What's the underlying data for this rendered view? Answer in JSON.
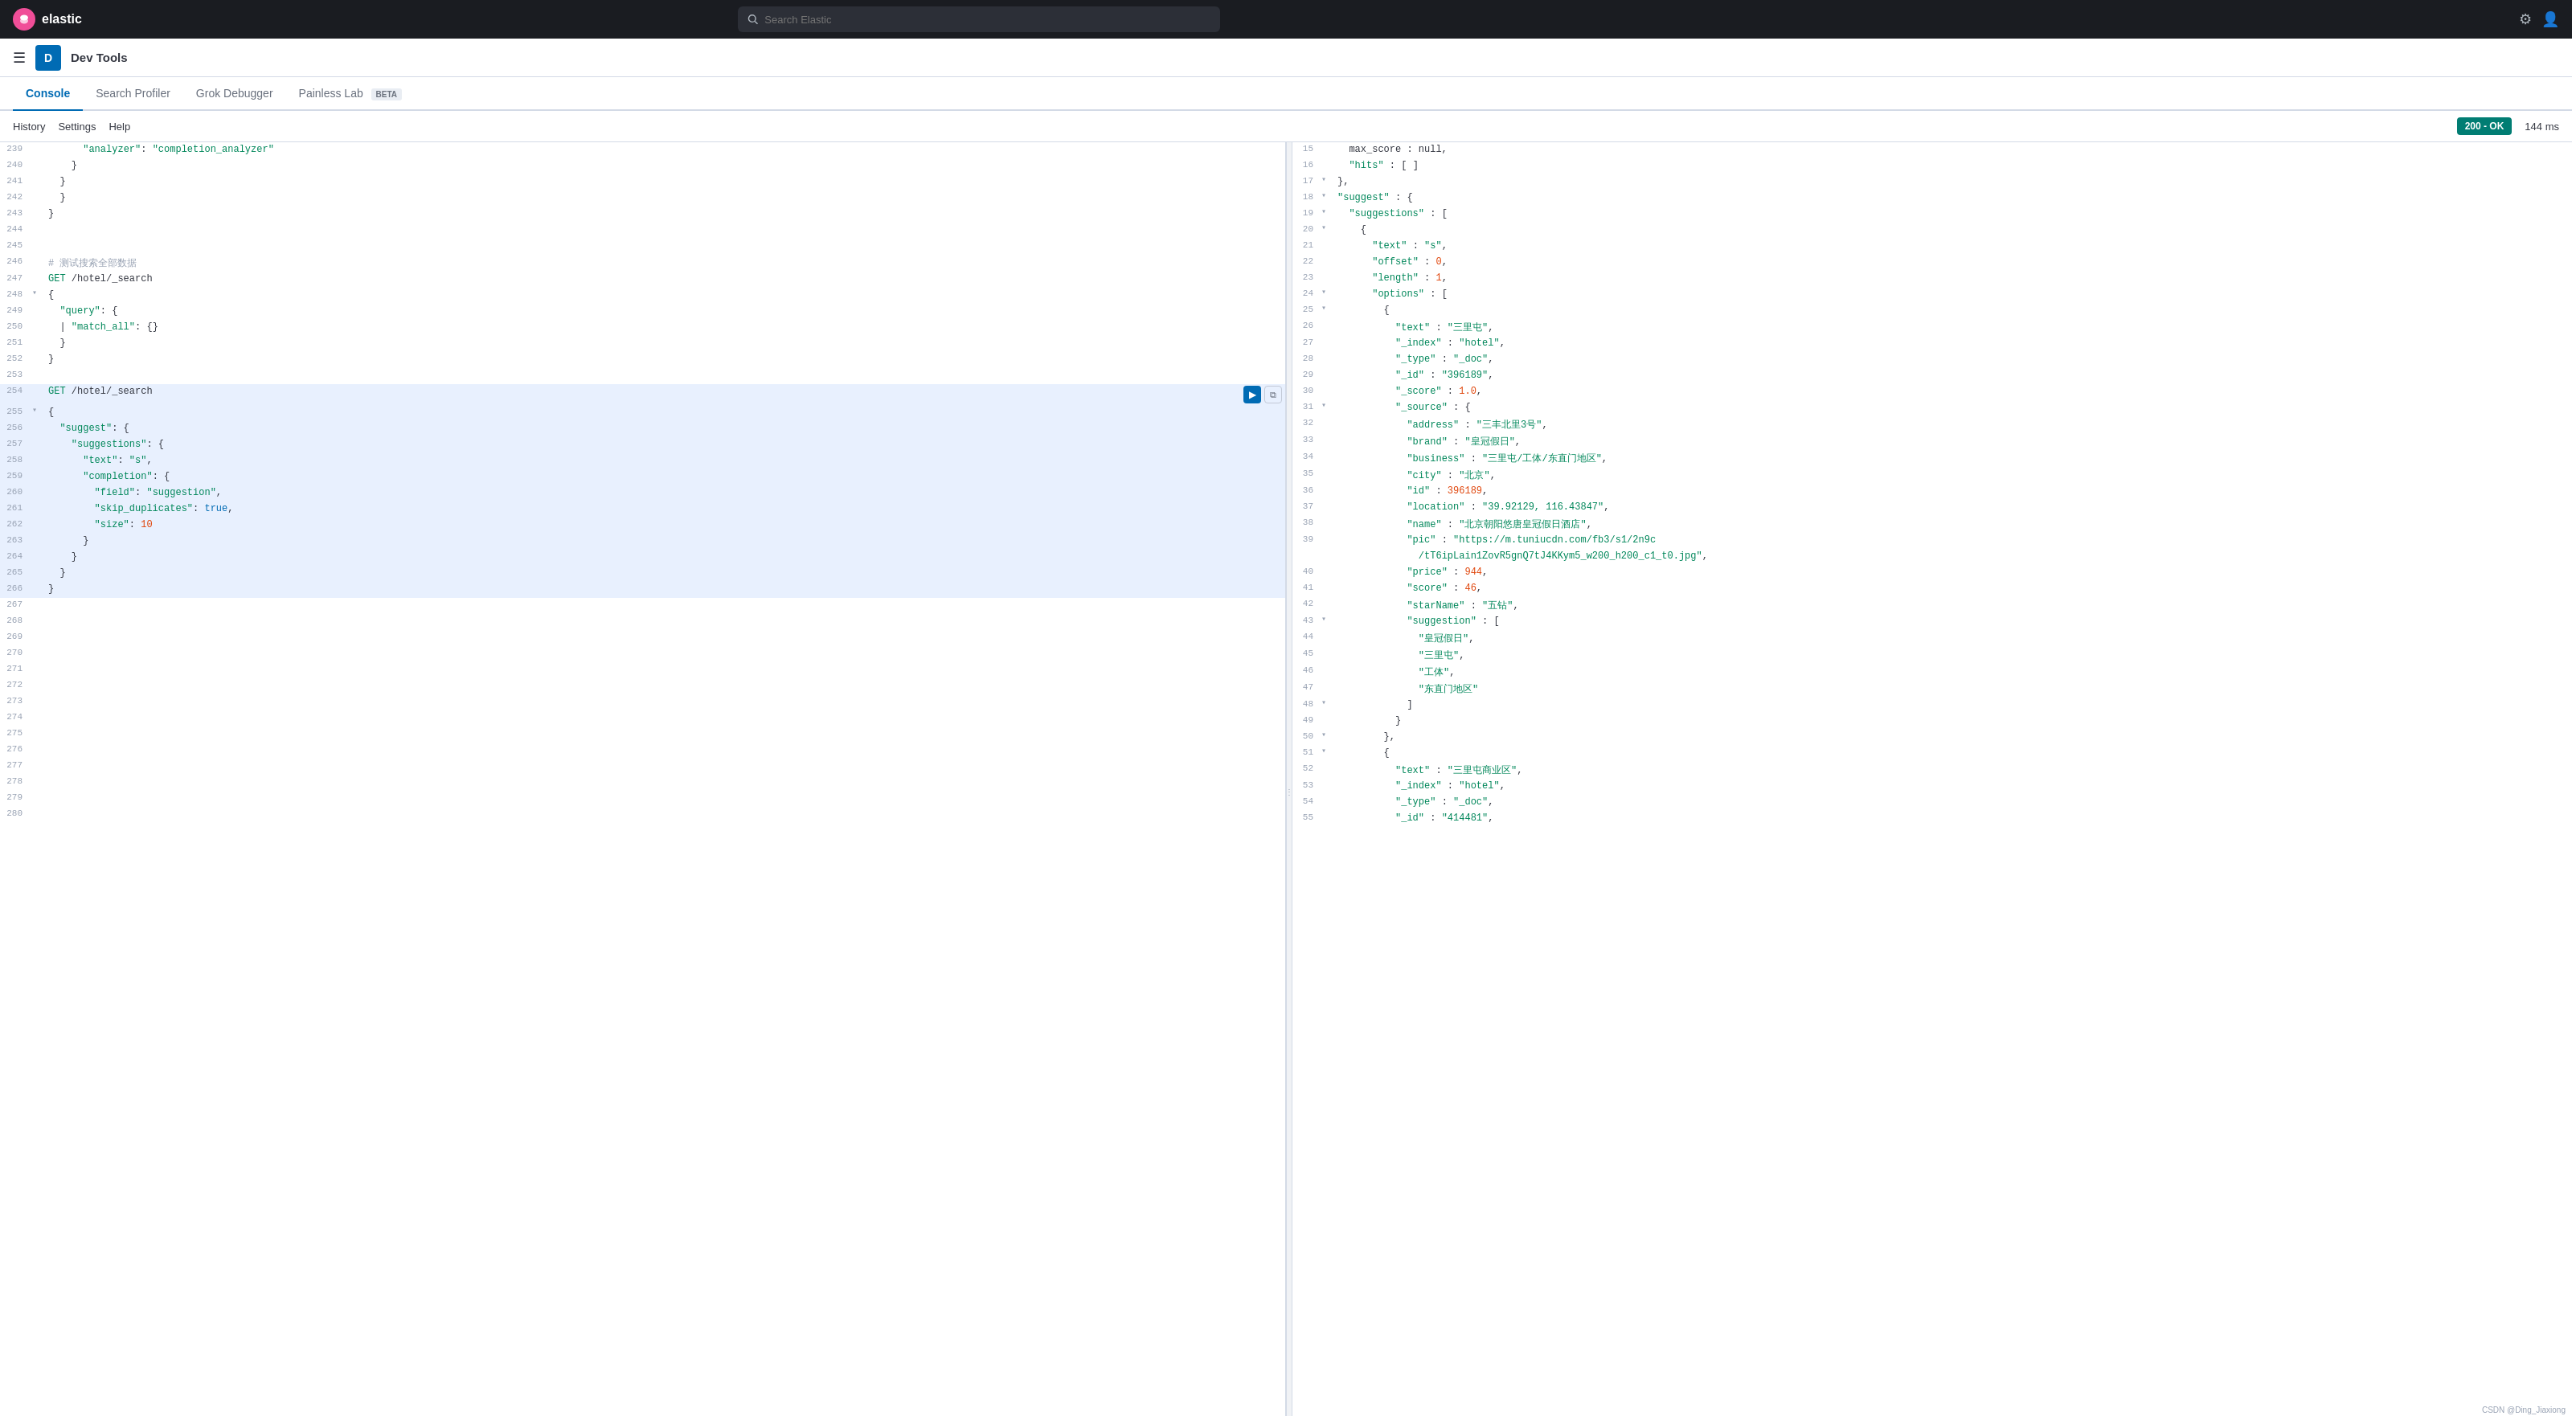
{
  "topNav": {
    "logoText": "elastic",
    "searchPlaceholder": "Search Elastic",
    "icons": [
      "gear-icon",
      "user-icon"
    ]
  },
  "headerBar": {
    "avatarLabel": "D",
    "appTitle": "Dev Tools"
  },
  "tabs": [
    {
      "label": "Console",
      "active": true
    },
    {
      "label": "Search Profiler",
      "active": false
    },
    {
      "label": "Grok Debugger",
      "active": false
    },
    {
      "label": "Painless Lab",
      "active": false,
      "badge": "BETA"
    }
  ],
  "subToolbar": {
    "history": "History",
    "settings": "Settings",
    "help": "Help",
    "status": "200 - OK",
    "time": "144 ms"
  },
  "editor": {
    "lines": [
      {
        "num": 239,
        "indent": "      ",
        "content": "\"analyzer\": \"completion_analyzer\"",
        "type": "string-pair"
      },
      {
        "num": 240,
        "indent": "    ",
        "content": "}",
        "type": "bracket"
      },
      {
        "num": 241,
        "indent": "  ",
        "content": "}",
        "type": "bracket"
      },
      {
        "num": 242,
        "indent": "  ",
        "content": "}",
        "type": "bracket"
      },
      {
        "num": 243,
        "indent": "",
        "content": "}",
        "type": "bracket"
      },
      {
        "num": 244,
        "indent": "",
        "content": "",
        "type": "empty"
      },
      {
        "num": 245,
        "indent": "",
        "content": "",
        "type": "empty"
      },
      {
        "num": 246,
        "indent": "",
        "content": "# 测试搜索全部数据",
        "type": "comment"
      },
      {
        "num": 247,
        "indent": "",
        "content": "GET /hotel/_search",
        "type": "method"
      },
      {
        "num": 248,
        "indent": "",
        "content": "{",
        "type": "bracket"
      },
      {
        "num": 249,
        "indent": "  ",
        "content": "\"query\": {",
        "type": "key-open"
      },
      {
        "num": 250,
        "indent": "  | ",
        "content": "\"match_all\": {}",
        "type": "key-value"
      },
      {
        "num": 251,
        "indent": "  ",
        "content": "}",
        "type": "bracket"
      },
      {
        "num": 252,
        "indent": "",
        "content": "}",
        "type": "bracket"
      },
      {
        "num": 253,
        "indent": "",
        "content": "",
        "type": "empty"
      },
      {
        "num": 254,
        "indent": "",
        "content": "GET /hotel/_search",
        "type": "method-active"
      },
      {
        "num": 255,
        "indent": "",
        "content": "{",
        "type": "bracket"
      },
      {
        "num": 256,
        "indent": "  ",
        "content": "\"suggest\": {",
        "type": "key-open"
      },
      {
        "num": 257,
        "indent": "    ",
        "content": "\"suggestions\": {",
        "type": "key-open"
      },
      {
        "num": 258,
        "indent": "      ",
        "content": "\"text\": \"s\",",
        "type": "key-value"
      },
      {
        "num": 259,
        "indent": "      ",
        "content": "\"completion\": {",
        "type": "key-open"
      },
      {
        "num": 260,
        "indent": "        ",
        "content": "\"field\": \"suggestion\",",
        "type": "key-value"
      },
      {
        "num": 261,
        "indent": "        ",
        "content": "\"skip_duplicates\": true,",
        "type": "key-value"
      },
      {
        "num": 262,
        "indent": "        ",
        "content": "\"size\": 10",
        "type": "key-value"
      },
      {
        "num": 263,
        "indent": "      ",
        "content": "}",
        "type": "bracket"
      },
      {
        "num": 264,
        "indent": "    ",
        "content": "}",
        "type": "bracket"
      },
      {
        "num": 265,
        "indent": "  ",
        "content": "}",
        "type": "bracket"
      },
      {
        "num": 266,
        "indent": "",
        "content": "}",
        "type": "bracket"
      },
      {
        "num": 267,
        "indent": "",
        "content": "",
        "type": "empty"
      },
      {
        "num": 268,
        "indent": "",
        "content": "",
        "type": "empty"
      },
      {
        "num": 269,
        "indent": "",
        "content": "",
        "type": "empty"
      },
      {
        "num": 270,
        "indent": "",
        "content": "",
        "type": "empty"
      },
      {
        "num": 271,
        "indent": "",
        "content": "",
        "type": "empty"
      },
      {
        "num": 272,
        "indent": "",
        "content": "",
        "type": "empty"
      },
      {
        "num": 273,
        "indent": "",
        "content": "",
        "type": "empty"
      },
      {
        "num": 274,
        "indent": "",
        "content": "",
        "type": "empty"
      },
      {
        "num": 275,
        "indent": "",
        "content": "",
        "type": "empty"
      },
      {
        "num": 276,
        "indent": "",
        "content": "",
        "type": "empty"
      },
      {
        "num": 277,
        "indent": "",
        "content": "",
        "type": "empty"
      },
      {
        "num": 278,
        "indent": "",
        "content": "",
        "type": "empty"
      },
      {
        "num": 279,
        "indent": "",
        "content": "",
        "type": "empty"
      },
      {
        "num": 280,
        "indent": "",
        "content": "",
        "type": "empty"
      }
    ]
  },
  "output": {
    "lines": [
      {
        "num": 15,
        "fold": "",
        "content": "  max_score : null,",
        "type": "normal"
      },
      {
        "num": 16,
        "fold": "",
        "content": "  \"hits\" : [ ]",
        "type": "normal"
      },
      {
        "num": 17,
        "fold": "▾",
        "content": "},",
        "type": "normal"
      },
      {
        "num": 18,
        "fold": "▾",
        "content": "\"suggest\" : {",
        "type": "key-open"
      },
      {
        "num": 19,
        "fold": "▾",
        "content": "  \"suggestions\" : [",
        "type": "key-open"
      },
      {
        "num": 20,
        "fold": "▾",
        "content": "    {",
        "type": "bracket"
      },
      {
        "num": 21,
        "fold": "",
        "content": "      \"text\" : \"s\",",
        "type": "string-pair"
      },
      {
        "num": 22,
        "fold": "",
        "content": "      \"offset\" : 0,",
        "type": "num-pair"
      },
      {
        "num": 23,
        "fold": "",
        "content": "      \"length\" : 1,",
        "type": "num-pair"
      },
      {
        "num": 24,
        "fold": "▾",
        "content": "      \"options\" : [",
        "type": "key-open"
      },
      {
        "num": 25,
        "fold": "▾",
        "content": "        {",
        "type": "bracket"
      },
      {
        "num": 26,
        "fold": "",
        "content": "          \"text\" : \"三里屯\",",
        "type": "string-pair"
      },
      {
        "num": 27,
        "fold": "",
        "content": "          \"_index\" : \"hotel\",",
        "type": "string-pair"
      },
      {
        "num": 28,
        "fold": "",
        "content": "          \"_type\" : \"_doc\",",
        "type": "string-pair"
      },
      {
        "num": 29,
        "fold": "",
        "content": "          \"_id\" : \"396189\",",
        "type": "string-pair"
      },
      {
        "num": 30,
        "fold": "",
        "content": "          \"_score\" : 1.0,",
        "type": "num-pair"
      },
      {
        "num": 31,
        "fold": "▾",
        "content": "          \"_source\" : {",
        "type": "key-open"
      },
      {
        "num": 32,
        "fold": "",
        "content": "            \"address\" : \"三丰北里3号\",",
        "type": "string-pair"
      },
      {
        "num": 33,
        "fold": "",
        "content": "            \"brand\" : \"皇冠假日\",",
        "type": "string-pair"
      },
      {
        "num": 34,
        "fold": "",
        "content": "            \"business\" : \"三里屯/工体/东直门地区\",",
        "type": "string-pair"
      },
      {
        "num": 35,
        "fold": "",
        "content": "            \"city\" : \"北京\",",
        "type": "string-pair"
      },
      {
        "num": 36,
        "fold": "",
        "content": "            \"id\" : 396189,",
        "type": "num-pair"
      },
      {
        "num": 37,
        "fold": "",
        "content": "            \"location\" : \"39.92129, 116.43847\",",
        "type": "string-pair"
      },
      {
        "num": 38,
        "fold": "",
        "content": "            \"name\" : \"北京朝阳悠唐皇冠假日酒店\",",
        "type": "string-pair"
      },
      {
        "num": 39,
        "fold": "",
        "content": "            \"pic\" : \"https://m.tuniucdn.com/fb3/s1/2n9c",
        "type": "string-pair"
      },
      {
        "num": 39,
        "fold": "",
        "content": "              /tT6ipLain1ZovR5gnQ7tJ4KKym5_w200_h200_c1_t0.jpg\",",
        "type": "string-pair"
      },
      {
        "num": 40,
        "fold": "",
        "content": "            \"price\" : 944,",
        "type": "num-pair"
      },
      {
        "num": 41,
        "fold": "",
        "content": "            \"score\" : 46,",
        "type": "num-pair"
      },
      {
        "num": 42,
        "fold": "",
        "content": "            \"starName\" : \"五钻\",",
        "type": "string-pair"
      },
      {
        "num": 43,
        "fold": "▾",
        "content": "            \"suggestion\" : [",
        "type": "key-open"
      },
      {
        "num": 44,
        "fold": "",
        "content": "              \"皇冠假日\",",
        "type": "string"
      },
      {
        "num": 45,
        "fold": "",
        "content": "              \"三里屯\",",
        "type": "string"
      },
      {
        "num": 46,
        "fold": "",
        "content": "              \"工体\",",
        "type": "string"
      },
      {
        "num": 47,
        "fold": "",
        "content": "              \"东直门地区\"",
        "type": "string"
      },
      {
        "num": 48,
        "fold": "▾",
        "content": "            ]",
        "type": "bracket"
      },
      {
        "num": 49,
        "fold": "",
        "content": "          }",
        "type": "bracket"
      },
      {
        "num": 50,
        "fold": "▾",
        "content": "        },",
        "type": "bracket"
      },
      {
        "num": 51,
        "fold": "▾",
        "content": "        {",
        "type": "bracket"
      },
      {
        "num": 52,
        "fold": "",
        "content": "          \"text\" : \"三里屯商业区\",",
        "type": "string-pair"
      },
      {
        "num": 53,
        "fold": "",
        "content": "          \"_index\" : \"hotel\",",
        "type": "string-pair"
      },
      {
        "num": 54,
        "fold": "",
        "content": "          \"_type\" : \"_doc\",",
        "type": "string-pair"
      },
      {
        "num": 55,
        "fold": "",
        "content": "          \"_id\" : \"414481\",",
        "type": "string-pair"
      }
    ]
  },
  "footer": {
    "text": "CSDN @Ding_Jiaxiong"
  }
}
